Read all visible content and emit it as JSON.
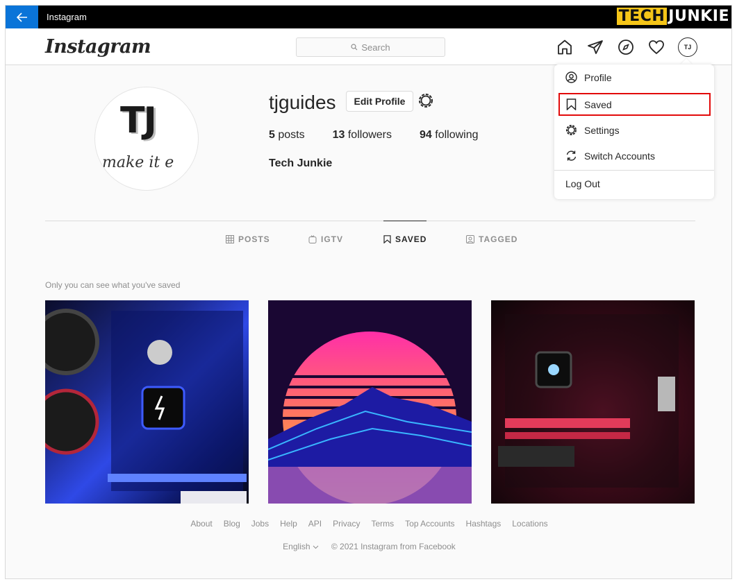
{
  "titlebar": {
    "title": "Instagram",
    "back_icon": "arrow-left-icon",
    "watermark_a": "TECH",
    "watermark_b": "JUNKIE"
  },
  "nav": {
    "logo": "Instagram",
    "search_placeholder": "Search",
    "icons": [
      "home-icon",
      "direct-icon",
      "explore-icon",
      "activity-heart-icon"
    ],
    "avatar_text": "TJ"
  },
  "profile": {
    "avatar_text": "TJ",
    "avatar_tagline": "make it e",
    "username": "tjguides",
    "edit_label": "Edit Profile",
    "posts_count": "5",
    "posts_label": "posts",
    "followers_count": "13",
    "followers_label": "followers",
    "following_count": "94",
    "following_label": "following",
    "full_name": "Tech Junkie"
  },
  "tabs": [
    {
      "label": "POSTS",
      "icon": "grid-icon"
    },
    {
      "label": "IGTV",
      "icon": "igtv-icon"
    },
    {
      "label": "SAVED",
      "icon": "bookmark-icon"
    },
    {
      "label": "TAGGED",
      "icon": "tagged-icon"
    }
  ],
  "active_tab": "SAVED",
  "saved_hint": "Only you can see what you've saved",
  "dropdown": {
    "items": [
      {
        "label": "Profile",
        "icon": "profile-circle-icon"
      },
      {
        "label": "Saved",
        "icon": "bookmark-icon"
      },
      {
        "label": "Settings",
        "icon": "settings-gear-icon"
      },
      {
        "label": "Switch Accounts",
        "icon": "switch-accounts-icon"
      }
    ],
    "logout": "Log Out",
    "highlight_color": "#e20a0a"
  },
  "footer": {
    "links": [
      "About",
      "Blog",
      "Jobs",
      "Help",
      "API",
      "Privacy",
      "Terms",
      "Top Accounts",
      "Hashtags",
      "Locations"
    ],
    "language": "English",
    "copyright": "© 2021 Instagram from Facebook"
  },
  "colors": {
    "titlebar": "#000000",
    "back_button": "#0a74d8",
    "text": "#262626",
    "muted": "#8e8e8e"
  }
}
